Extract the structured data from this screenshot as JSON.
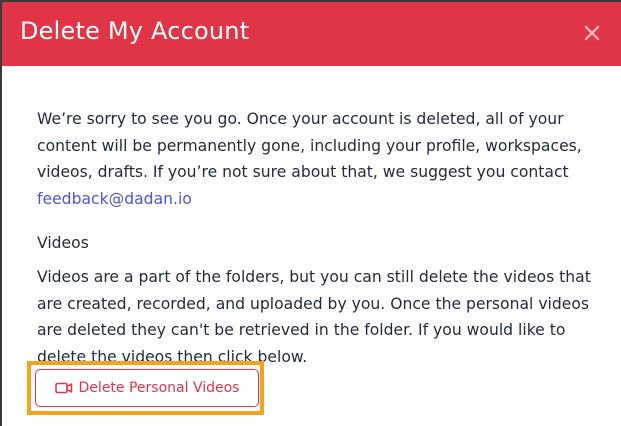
{
  "modal": {
    "title": "Delete My Account",
    "close_icon": "close-icon"
  },
  "body": {
    "intro_text": "We’re sorry to see you go. Once your account is deleted, all of your content will be permanently gone, including your profile, workspaces, videos, drafts. If you’re not sure about that, we suggest you contact ",
    "feedback_email": "feedback@dadan.io",
    "videos_heading": "Videos",
    "videos_text": "Videos are a part of the folders, but you can still delete the videos that are created, recorded, and uploaded by you. Once the personal videos are deleted they can't be retrieved in the folder. If you would like to delete the videos then click below."
  },
  "actions": {
    "delete_videos_label": "Delete Personal Videos",
    "delete_videos_icon": "video-camera-icon"
  },
  "colors": {
    "header_bg": "#e03547",
    "accent_red": "#e03547",
    "link_blue": "#4a56d8",
    "highlight_orange": "#f6a21b",
    "text_dark": "#1e2a45"
  }
}
